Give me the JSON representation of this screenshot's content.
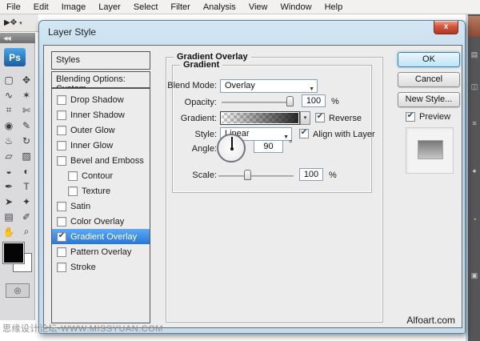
{
  "menu": {
    "items": [
      "File",
      "Edit",
      "Image",
      "Layer",
      "Select",
      "Filter",
      "Analysis",
      "View",
      "Window",
      "Help"
    ]
  },
  "toolbar": {
    "collapse_label": "◀◀",
    "logo": "Ps",
    "options_move_glyph": "▶✥",
    "options_dropdown_glyph": "▾",
    "tools": [
      {
        "name": "rectangular-marquee",
        "glyph": "▢"
      },
      {
        "name": "move",
        "glyph": "✥"
      },
      {
        "name": "lasso",
        "glyph": "∿"
      },
      {
        "name": "magic-wand",
        "glyph": "✶"
      },
      {
        "name": "crop",
        "glyph": "⌗"
      },
      {
        "name": "slice",
        "glyph": "✄"
      },
      {
        "name": "healing-brush",
        "glyph": "◉"
      },
      {
        "name": "brush",
        "glyph": "✎"
      },
      {
        "name": "clone-stamp",
        "glyph": "♨"
      },
      {
        "name": "history-brush",
        "glyph": "↻"
      },
      {
        "name": "eraser",
        "glyph": "▱"
      },
      {
        "name": "gradient",
        "glyph": "▨"
      },
      {
        "name": "blur",
        "glyph": "◒"
      },
      {
        "name": "dodge",
        "glyph": "◐"
      },
      {
        "name": "pen",
        "glyph": "✒"
      },
      {
        "name": "type",
        "glyph": "T"
      },
      {
        "name": "path-selection",
        "glyph": "➤"
      },
      {
        "name": "custom-shape",
        "glyph": "✦"
      },
      {
        "name": "notes",
        "glyph": "▤"
      },
      {
        "name": "eyedropper",
        "glyph": "✐"
      },
      {
        "name": "hand",
        "glyph": "✋"
      },
      {
        "name": "zoom",
        "glyph": "⌕"
      }
    ],
    "quickmask_glyph": "◎"
  },
  "dock": {
    "icons": [
      "▤",
      "◫",
      "≡",
      "✦",
      "◔",
      "▣"
    ]
  },
  "dialog": {
    "title": "Layer Style",
    "close_glyph": "x",
    "left_panel": {
      "header": "Styles",
      "blending_options": "Blending Options: Custom",
      "items": [
        {
          "label": "Drop Shadow"
        },
        {
          "label": "Inner Shadow"
        },
        {
          "label": "Outer Glow"
        },
        {
          "label": "Inner Glow"
        },
        {
          "label": "Bevel and Emboss"
        },
        {
          "label": "Contour"
        },
        {
          "label": "Texture"
        },
        {
          "label": "Satin"
        },
        {
          "label": "Color Overlay"
        },
        {
          "label": "Gradient Overlay"
        },
        {
          "label": "Pattern Overlay"
        },
        {
          "label": "Stroke"
        }
      ]
    },
    "main": {
      "section_title": "Gradient Overlay",
      "group_title": "Gradient",
      "blend_mode": {
        "label": "Blend Mode:",
        "value": "Overlay"
      },
      "opacity": {
        "label": "Opacity:",
        "value": "100",
        "unit": "%"
      },
      "gradient": {
        "label": "Gradient:",
        "reverse_label": "Reverse"
      },
      "style": {
        "label": "Style:",
        "value": "Linear",
        "align_label": "Align with Layer"
      },
      "angle": {
        "label": "Angle:",
        "value": "90",
        "unit": "°"
      },
      "scale": {
        "label": "Scale:",
        "value": "100",
        "unit": "%"
      }
    },
    "buttons": {
      "ok": "OK",
      "cancel": "Cancel",
      "new_style": "New Style...",
      "preview_label": "Preview"
    }
  },
  "icons": {
    "check": "✔",
    "dropdown_arrow": "▼",
    "small_arrow": "▾"
  },
  "watermarks": {
    "left": "思缘设计论坛-WWW.MISSYUAN.COM",
    "right": "Alfoart.com"
  },
  "colors": {
    "selection_blue": "#2677d8",
    "ok_border_blue": "#3c7fb1",
    "close_red": "#ad3a22",
    "dialog_glass": "#c4dcee"
  }
}
